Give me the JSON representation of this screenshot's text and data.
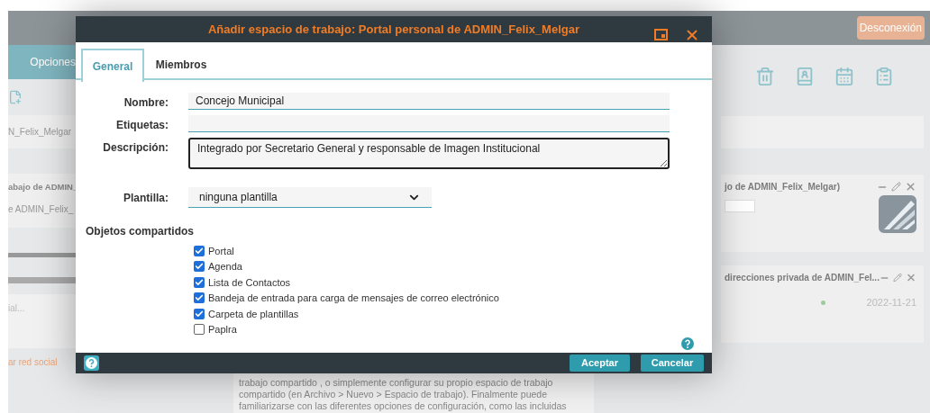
{
  "app": {
    "logout_button": "Desconexión",
    "menu_tab": "Opciones",
    "sidebar": {
      "user_label": "N_Felix_Melgar",
      "card_title": "abajo de ADMIN_",
      "card_text": "e ADMIN_Felix_",
      "input_text": "ial...",
      "link": "ar red social"
    },
    "cards": [
      {
        "kind": "logo",
        "title": "jo de ADMIN_Felix_Melgar)"
      },
      {
        "kind": "status",
        "title": "direcciones privada de ADMIN_Fel...",
        "date": "2022-11-21"
      }
    ],
    "help_text": [
      "trabajo compartido , o simplemente configurar su propio espacio de trabajo",
      "compartido (en Archivo > Nuevo > Espacio de trabajo). Finalmente puede",
      "familiarizarse con las diferentes opciones de configuración, como las incluidas"
    ]
  },
  "dialog": {
    "title": "Añadir espacio de trabajo: Portal personal de ADMIN_Felix_Melgar",
    "tabs": [
      {
        "label": "General",
        "selected": true
      },
      {
        "label": "Miembros",
        "selected": false
      }
    ],
    "fields": [
      {
        "kind": "text",
        "label": "Nombre:",
        "value": "Concejo Municipal"
      },
      {
        "kind": "text",
        "label": "Etiquetas:"
      },
      {
        "kind": "textarea",
        "label": "Descripción:",
        "value": "Integrado por Secretario General y responsable de Imagen Institucional"
      },
      {
        "kind": "select",
        "label": "Plantilla:",
        "value": "ninguna plantilla"
      }
    ],
    "shared_heading": "Objetos compartidos",
    "shared_objects": [
      {
        "label": "Portal",
        "checked": true
      },
      {
        "label": "Agenda",
        "checked": true
      },
      {
        "label": "Lista de Contactos",
        "checked": true
      },
      {
        "label": "Bandeja de entrada para carga de mensajes de correo electrónico",
        "checked": true
      },
      {
        "label": "Carpeta de plantillas",
        "checked": true
      },
      {
        "label": "Paplra",
        "checked": false
      }
    ],
    "buttons": [
      "Aceptar",
      "Cancelar"
    ]
  }
}
